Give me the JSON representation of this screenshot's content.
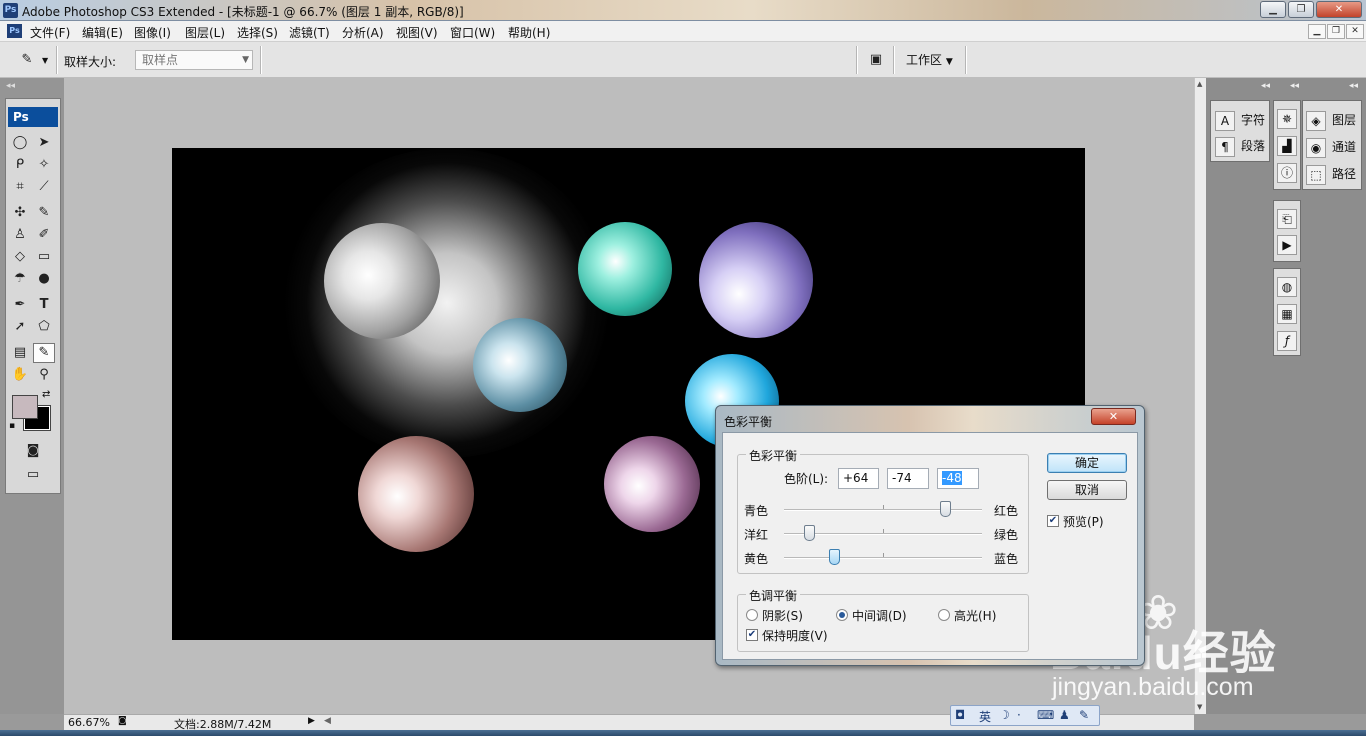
{
  "window": {
    "title": "Adobe Photoshop CS3 Extended - [未标题-1 @ 66.7% (图层 1 副本, RGB/8)]",
    "app_icon": "Ps",
    "controls": [
      "minimize-icon",
      "maximize-icon",
      "close-icon"
    ]
  },
  "menubar": {
    "items": [
      "文件(F)",
      "编辑(E)",
      "图像(I)",
      "图层(L)",
      "选择(S)",
      "滤镜(T)",
      "分析(A)",
      "视图(V)",
      "窗口(W)",
      "帮助(H)"
    ]
  },
  "options": {
    "sample_size_label": "取样大小:",
    "sample_size_value": "取样点",
    "workspace_label": "工作区"
  },
  "toolbox": {
    "header": "Ps",
    "foreground_color": "#c7b9be",
    "background_color": "#000000"
  },
  "panels": {
    "group1": [
      "字符",
      "段落"
    ],
    "group3": [
      "图层",
      "通道",
      "路径"
    ]
  },
  "status": {
    "zoom": "66.67%",
    "doc_info": "文档:2.88M/7.42M"
  },
  "dialog": {
    "title": "色彩平衡",
    "ok": "确定",
    "cancel": "取消",
    "preview_label": "预览(P)",
    "preview_checked": true,
    "color_balance": {
      "group_title": "色彩平衡",
      "levels_label": "色阶(L):",
      "levels": [
        "+64",
        "-74",
        "-48"
      ],
      "sliders": [
        {
          "left": "青色",
          "right": "红色",
          "value": 64
        },
        {
          "left": "洋红",
          "right": "绿色",
          "value": -74
        },
        {
          "left": "黄色",
          "right": "蓝色",
          "value": -48
        }
      ]
    },
    "tone_balance": {
      "group_title": "色调平衡",
      "options": [
        "阴影(S)",
        "中间调(D)",
        "高光(H)"
      ],
      "selected": "中间调(D)",
      "preserve_luminosity_label": "保持明度(V)",
      "preserve_luminosity_checked": true
    }
  },
  "watermark": {
    "brand": "Baidu经验",
    "url": "jingyan.baidu.com"
  },
  "ime": {
    "mode": "英"
  },
  "colors": {
    "accent": "#0b4e9c",
    "canvas_bg": "#000000"
  }
}
